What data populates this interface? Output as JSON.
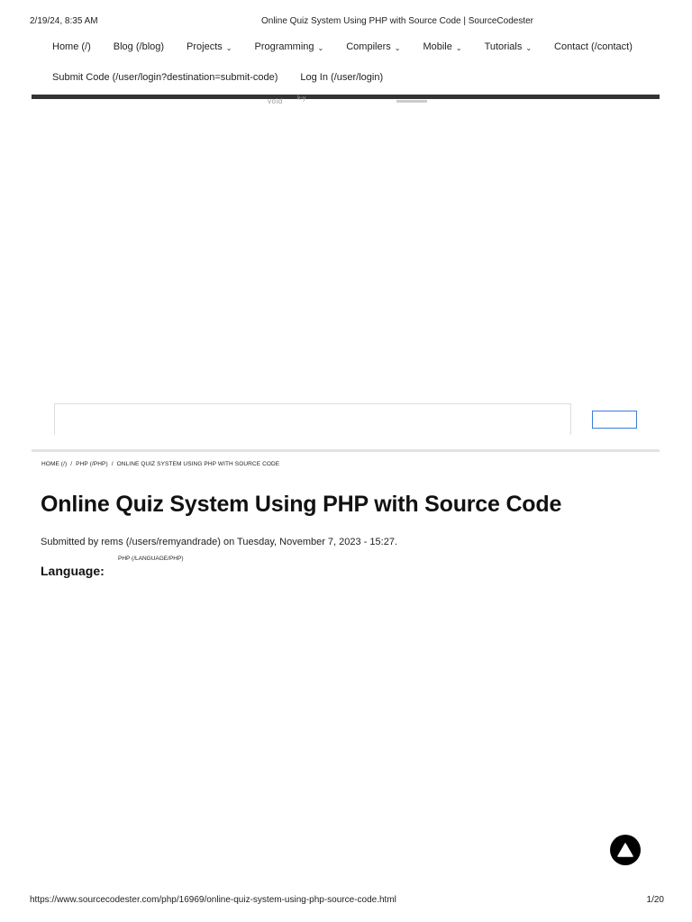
{
  "print_header": {
    "date": "2/19/24, 8:35 AM",
    "title": "Online Quiz System Using PHP with Source Code | SourceCodester"
  },
  "nav": {
    "row1": [
      {
        "label": "Home (/)",
        "dropdown": false
      },
      {
        "label": "Blog (/blog)",
        "dropdown": false
      },
      {
        "label": "Projects",
        "dropdown": true
      },
      {
        "label": "Programming",
        "dropdown": true
      },
      {
        "label": "Compilers",
        "dropdown": true
      },
      {
        "label": "Mobile",
        "dropdown": true
      },
      {
        "label": "Tutorials",
        "dropdown": true
      },
      {
        "label": "Contact (/contact)",
        "dropdown": false
      }
    ],
    "row2": [
      {
        "label": "Submit Code (/user/login?destination=submit-code)",
        "dropdown": false
      },
      {
        "label": "Log In (/user/login)",
        "dropdown": false
      }
    ],
    "caret": "⌄"
  },
  "faded": {
    "text": "void",
    "text2": "k-y"
  },
  "breadcrumb": {
    "items": [
      "HOME (/)",
      "PHP (/PHP)",
      "ONLINE QUIZ SYSTEM USING PHP WITH SOURCE CODE"
    ],
    "separator": "/"
  },
  "article": {
    "title": "Online Quiz System Using PHP with Source Code",
    "submitted": "Submitted by rems (/users/remyandrade) on Tuesday, November 7, 2023 - 15:27.",
    "language_label": "Language:",
    "language_value": "PHP (/LANGUAGE/PHP)"
  },
  "print_footer": {
    "url": "https://www.sourcecodester.com/php/16969/online-quiz-system-using-php-source-code.html",
    "page": "1/20"
  },
  "icons": {
    "scroll_top": "scroll-to-top-icon"
  },
  "colors": {
    "nav_bar": "#333333",
    "search_button_border": "#3b7dd8",
    "scroll_top_bg": "#000000"
  }
}
